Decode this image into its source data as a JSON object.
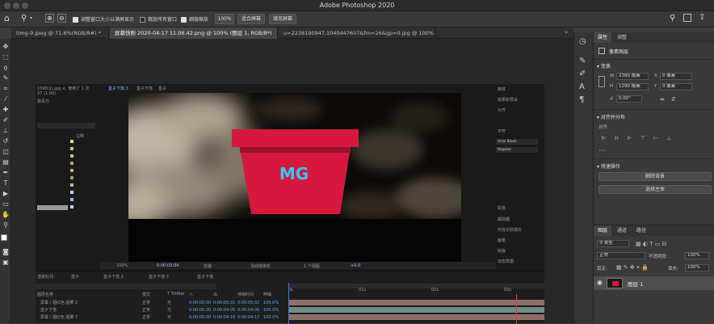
{
  "app": {
    "title": "Adobe Photoshop 2020"
  },
  "options_bar": {
    "home_icon": "home-icon",
    "zoom_icon": "zoom-icon",
    "resize_windows_label": "调整窗口大小以满屏显示",
    "zoom_all_label": "缩放所有窗口",
    "scrubby_zoom_label": "细微缩放",
    "zoom_value": "100%",
    "fit_screen_label": "适合屏幕",
    "fill_screen_label": "填充屏幕"
  },
  "doc_tabs": [
    {
      "label": "timg-9.jpeg @ 71.6%(RGB/8#) *"
    },
    {
      "label": "屏幕快照 2020-04-17 11.06.42.png @ 100% (图层 1, RGB/8*)"
    },
    {
      "label": "u=2238190947,1040447607&fm=26&gp=0.jpg @ 100% (RGB/8#)"
    }
  ],
  "ae": {
    "project_info": [
      "1590(1).jpg ×, 使用了 1 次",
      "97 (1.00)",
      "数百万"
    ],
    "comp_tabs": [
      "盒子下落 3",
      "盒子下落",
      "盒子"
    ],
    "project_col": "注释",
    "logo_text": "MG",
    "right_panel": [
      "媒体",
      "效果和预设",
      "对齐",
      "字符",
      "Arial Black",
      "Regular",
      "段落",
      "跟踪器",
      "内容识别填充",
      "画笔",
      "绘画",
      "摇摆器",
      "动态草图"
    ],
    "viewer_bar": [
      "100%",
      "0:00:03:04",
      "完整",
      "活动摄像机",
      "1 个视图",
      "+0.0"
    ],
    "timeline_tabs": [
      "渲染队列",
      "盒子",
      "盒子下落 2",
      "盒子下落 3",
      "盒子下落"
    ],
    "timecode": "0:00:03:04",
    "ruler": [
      "0s",
      "01s",
      "02s",
      "03s"
    ],
    "columns": [
      "图层名称",
      "模式",
      "T TrkMat",
      "父级",
      "入",
      "出",
      "持续时间",
      "伸缩"
    ],
    "rows": [
      {
        "name": "屏幕 / 烟红色 烟雾 2",
        "mode": "正常",
        "trk": "无",
        "in": "0:00:00:00",
        "out": "0:00:05:01",
        "dur": "0:00:05:02",
        "stretch": "100.0%"
      },
      {
        "name": "盒子下落",
        "mode": "正常",
        "trk": "无",
        "in": "0:00:00:00",
        "out": "0:00:04:05",
        "dur": "0:00:04:06",
        "stretch": "100.0%"
      },
      {
        "name": "屏幕 / 烟红色 烟雾 7",
        "mode": "正常",
        "trk": "无",
        "in": "0:00:00:00",
        "out": "0:00:04:16",
        "dur": "0:00:04:17",
        "stretch": "100.0%"
      }
    ]
  },
  "properties": {
    "tabs": [
      "属性",
      "调整"
    ],
    "pixel_layer": "像素图层",
    "transform": {
      "title": "变换",
      "w": "2380 像素",
      "x": "0 像素",
      "h": "1290 像素",
      "y": "0 像素",
      "angle": "0.00°"
    },
    "align": {
      "title": "对齐并分布",
      "sub": "对齐:"
    },
    "quick_actions": {
      "title": "快速操作",
      "remove_bg": "删除背景",
      "select_subject": "选择主体"
    }
  },
  "layers": {
    "tabs": [
      "图层",
      "通道",
      "路径"
    ],
    "filter_kind": "类型",
    "blend_mode": "正常",
    "opacity_label": "不透明度:",
    "opacity": "100%",
    "lock_label": "锁定:",
    "fill_label": "填充:",
    "fill": "100%",
    "items": [
      {
        "name": "图层 1"
      }
    ]
  },
  "colors": {
    "accent": "#2d8ceb",
    "logo_red": "#d6183f",
    "logo_text": "#37c8f0"
  }
}
